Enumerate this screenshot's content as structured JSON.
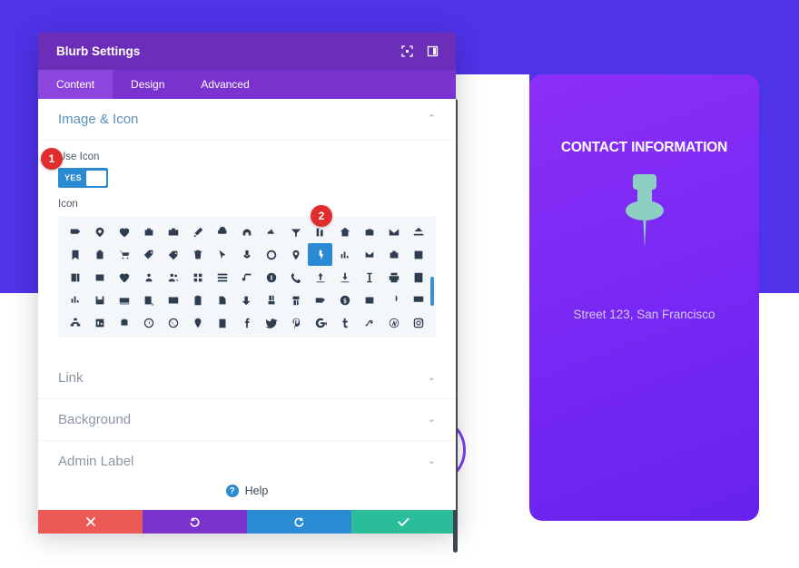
{
  "modal": {
    "title": "Blurb Settings",
    "header_icons": [
      {
        "name": "fullscreen-icon"
      },
      {
        "name": "layout-toggle-icon"
      }
    ],
    "tabs": [
      {
        "label": "Content",
        "active": true
      },
      {
        "label": "Design",
        "active": false
      },
      {
        "label": "Advanced",
        "active": false
      }
    ],
    "sections": [
      {
        "label": "Image & Icon",
        "open": true,
        "chevron": "⌃"
      },
      {
        "label": "Link",
        "open": false,
        "chevron": "⌄"
      },
      {
        "label": "Background",
        "open": false,
        "chevron": "⌄"
      },
      {
        "label": "Admin Label",
        "open": false,
        "chevron": "⌄"
      }
    ],
    "use_icon": {
      "label": "Use Icon",
      "toggle_value": "YES"
    },
    "icon_field": {
      "label": "Icon",
      "selected_index": 25,
      "selected_icon_name": "map-pin-icon"
    },
    "help": {
      "label": "Help",
      "icon_glyph": "?"
    },
    "footer_buttons": [
      {
        "name": "cancel-button",
        "glyph": "✖"
      },
      {
        "name": "undo-button",
        "glyph": "↺"
      },
      {
        "name": "redo-button",
        "glyph": "↻"
      },
      {
        "name": "save-button",
        "glyph": "✔"
      }
    ]
  },
  "markers": [
    {
      "number": "1"
    },
    {
      "number": "2"
    }
  ],
  "page": {
    "contact_card": {
      "title": "CONTACT INFORMATION",
      "icon_name": "map-pin-icon",
      "address": "Street 123, San Francisco"
    }
  },
  "colors": {
    "page_background": "#4f33e8",
    "contact_card": "#7b2ff7",
    "modal_header": "#6c2eb9",
    "modal_tabs": "#7b33cf",
    "tab_active": "#8c45dd",
    "toggle_on": "#2a8ad4",
    "selected_icon": "#2a8ad4",
    "marker": "#e02c2c",
    "cancel": "#ec5a56",
    "undo": "#7b33cf",
    "redo": "#2a8ad4",
    "save": "#2bbd9a",
    "pin_icon": "#8ecfc4",
    "section_open_title": "#5a8fbe",
    "section_title": "#8a96a3"
  },
  "icon_rows": [
    [
      "",
      "",
      "",
      "",
      "",
      "",
      "",
      "",
      "",
      "",
      "",
      "",
      "",
      "",
      ""
    ],
    [
      "",
      "",
      "",
      "",
      "",
      "",
      "",
      "",
      "",
      "",
      "",
      "",
      "",
      "",
      ""
    ],
    [
      "",
      "",
      "",
      "",
      "",
      "",
      "",
      "",
      "",
      "",
      "",
      "",
      "",
      "",
      ""
    ],
    [
      "",
      "",
      "",
      "",
      "",
      "",
      "",
      "",
      "",
      "",
      "",
      "",
      "",
      "",
      ""
    ],
    [
      "",
      "",
      "",
      "",
      "",
      "",
      "",
      "",
      "",
      "",
      "",
      "",
      "",
      "",
      ""
    ]
  ]
}
